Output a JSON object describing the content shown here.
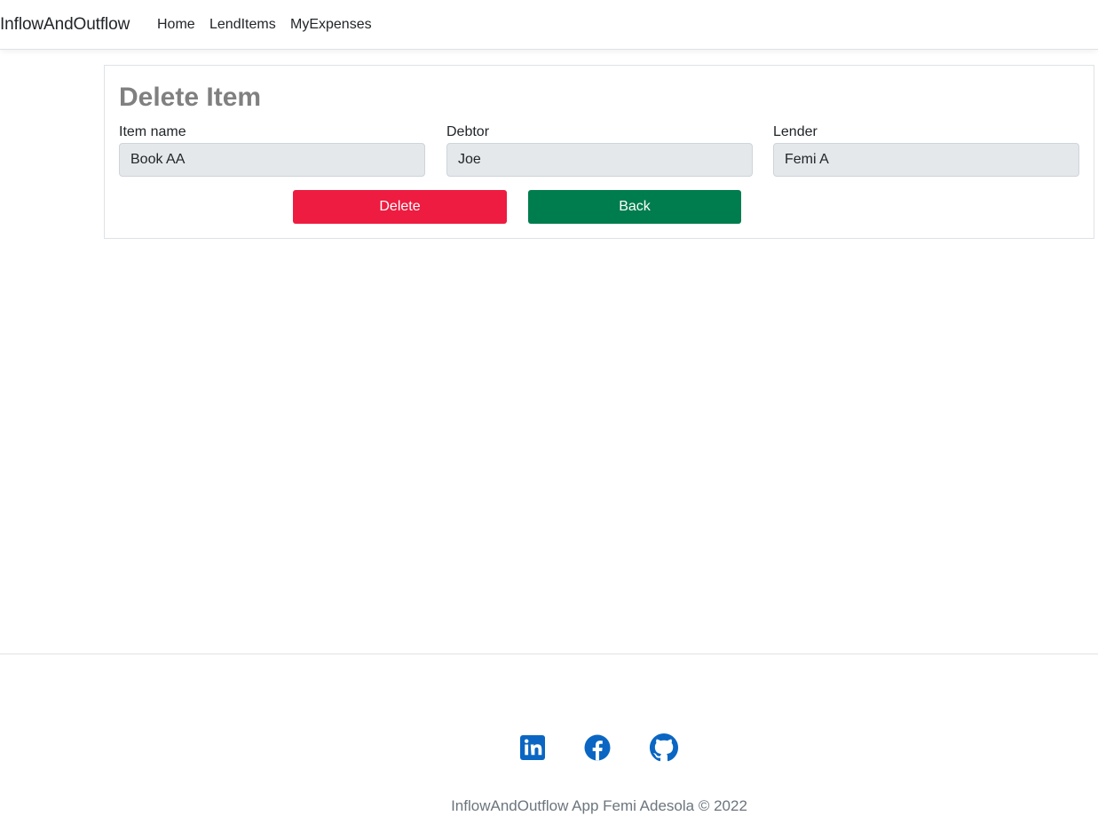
{
  "nav": {
    "brand": "InflowAndOutflow",
    "links": [
      "Home",
      "LendItems",
      "MyExpenses"
    ]
  },
  "form": {
    "title": "Delete Item",
    "fields": [
      {
        "label": "Item name",
        "value": "Book AA"
      },
      {
        "label": "Debtor",
        "value": "Joe"
      },
      {
        "label": "Lender",
        "value": "Femi A"
      }
    ],
    "delete_label": "Delete",
    "back_label": "Back"
  },
  "footer": {
    "social_icons": [
      "linkedin-icon",
      "facebook-icon",
      "github-icon"
    ],
    "text": "InflowAndOutflow App Femi Adesola © 2022"
  },
  "colors": {
    "delete_button": "#ee1c40",
    "back_button": "#007d4e",
    "social_icon": "#0a66c2",
    "title": "#808080",
    "input_background": "#e5e8eb"
  }
}
